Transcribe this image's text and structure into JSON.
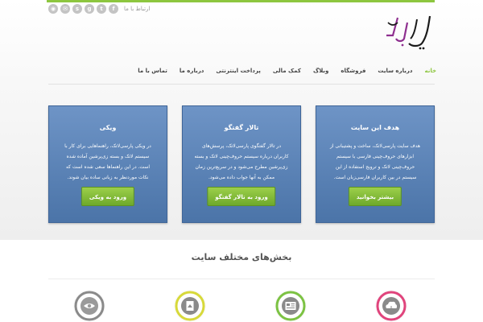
{
  "header": {
    "contact_label": "ارتباط با ما",
    "social_icons": [
      "rss-icon",
      "email-icon",
      "skype-icon",
      "google-plus-icon",
      "twitter-icon",
      "facebook-icon"
    ],
    "logo_text": "پارسی‌لاتک"
  },
  "nav": {
    "items": [
      {
        "label": "خانه",
        "active": true
      },
      {
        "label": "درباره سایت",
        "active": false
      },
      {
        "label": "فروشگاه",
        "active": false
      },
      {
        "label": "وبلاگ",
        "active": false
      },
      {
        "label": "کمک مالی",
        "active": false
      },
      {
        "label": "پرداخت اینترنتی",
        "active": false
      },
      {
        "label": "درباره ما",
        "active": false
      },
      {
        "label": "تماس با ما",
        "active": false
      }
    ]
  },
  "boxes": [
    {
      "title": "ویکی",
      "text": "در ویکی پارسی‌لاتک، راهنماهایی برای کار با سیستم لاتک و بسته زی‌پرشین آماده شده است. در این راهنماها سعی شده است که نکات موردنظر به زبانی ساده بیان شوند.",
      "button": "ورود به ویکی"
    },
    {
      "title": "تالار گفتگو",
      "text": "در تالار گفتگوی پارسی‌لاتک، پرسش‌های کاربران درباره سیستم حروف‌چینی لاتک و بسته زی‌پرشین مطرح می‌شود و در سریع‌ترین زمان ممکن به آنها جواب داده می‌شود.",
      "button": "ورود به تالار گفتگو"
    },
    {
      "title": "هدف این سایت",
      "text": "هدف سایت پارسی‌لاتک، ساخت و پشتیبانی از ابزارهای حروف‌چینی فارسی با سیستم حروف‌چینی لاتک و ترویج استفاده از این سیستم در بین کاربران فارسی‌زبان است.",
      "button": "بیشتر بخوانید"
    }
  ],
  "sections": {
    "title": "بخش‌های مختلف سایت",
    "circles": [
      {
        "icon": "eye-icon",
        "color": "#8a8a8a"
      },
      {
        "icon": "document-icon",
        "color": "#d7d93a"
      },
      {
        "icon": "newspaper-icon",
        "color": "#7cc243"
      },
      {
        "icon": "cloud-icon",
        "color": "#e0447c"
      }
    ]
  },
  "colors": {
    "accent_green": "#8dc63f",
    "box_blue": "#5b82b6",
    "logo_purple": "#8e2f8f"
  }
}
